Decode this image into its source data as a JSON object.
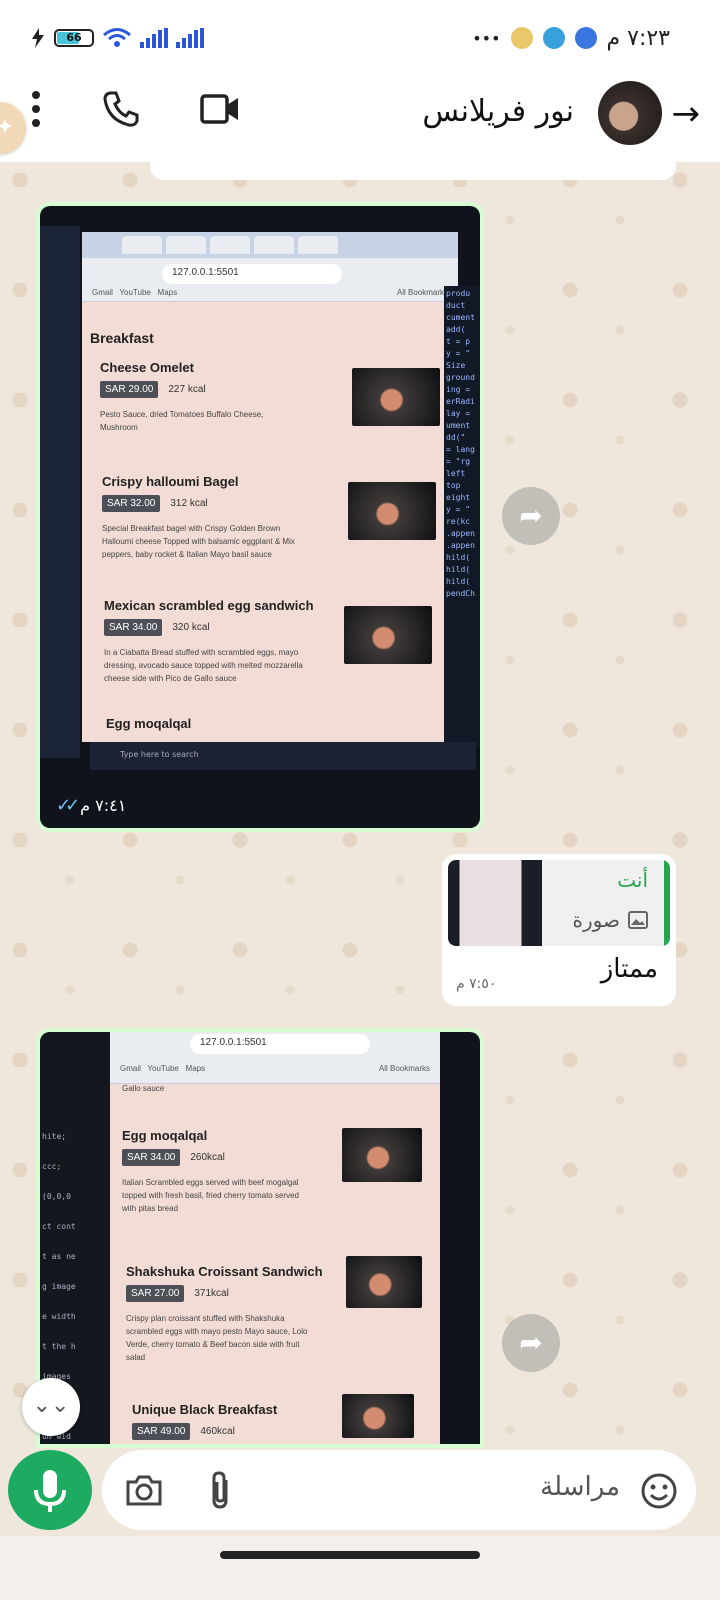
{
  "status_bar": {
    "time": "٧:٢٣ م",
    "battery": "66",
    "overflow": "•••"
  },
  "header": {
    "contact_name": "نور فريلانس",
    "back": "→"
  },
  "messages": [
    {
      "type": "image",
      "direction": "incoming",
      "time": "٧:٤١ م",
      "screen": {
        "url": "127.0.0.1:5501",
        "bookmarks": [
          "Gmail",
          "YouTube",
          "Maps"
        ],
        "all_bookmarks": "All Bookmarks",
        "section": "Breakfast",
        "items": [
          {
            "name": "Cheese Omelet",
            "price": "SAR 29.00",
            "kcal": "227 kcal",
            "desc": "Pesto Sauce, dried Tomatoes Buffalo Cheese, Mushroom"
          },
          {
            "name": "Crispy halloumi Bagel",
            "price": "SAR 32.00",
            "kcal": "312 kcal",
            "desc": "Special Breakfast bagel with Crispy Golden Brown Halloumi cheese Topped with balsamic eggplant & Mix peppers, baby rocket & Italian Mayo basil sauce"
          },
          {
            "name": "Mexican scrambled egg sandwich",
            "price": "SAR 34.00",
            "kcal": "320 kcal",
            "desc": "In a Ciabatta Bread stuffed with scrambled eggs, mayo dressing, avocado sauce topped with melted mozzarella cheese side with Pico de Gallo sauce"
          },
          {
            "name": "Egg moqalqal",
            "price": "",
            "kcal": "",
            "desc": ""
          }
        ],
        "search_placeholder": "Type here to search"
      }
    },
    {
      "type": "text",
      "direction": "outgoing",
      "reply_to": {
        "sender": "أنت",
        "kind": "صورة"
      },
      "text": "ممتاز",
      "time": "٧:٥٠ م"
    },
    {
      "type": "image",
      "direction": "incoming",
      "screen": {
        "url": "127.0.0.1:5501",
        "bookmarks": [
          "Gmail",
          "YouTube",
          "Maps"
        ],
        "all_bookmarks": "All Bookmarks",
        "top_fragment": "Gallo sauce",
        "items": [
          {
            "name": "Egg moqalqal",
            "price": "SAR 34.00",
            "kcal": "260kcal",
            "desc": "Italian Scrambled eggs served with beef mogalgal topped with fresh basil, fried cherry tomato served with pitas bread"
          },
          {
            "name": "Shakshuka Croissant Sandwich",
            "price": "SAR 27.00",
            "kcal": "371kcal",
            "desc": "Crispy plan croissant stuffed with Shakshuka scrambled eggs with mayo pesto Mayo sauce, Lolo Verde, cherry tomato & Beef bacon side with fruit salad"
          },
          {
            "name": "Unique Black Breakfast",
            "price": "SAR 49.00",
            "kcal": "460kcal",
            "desc": ""
          }
        ]
      }
    }
  ],
  "composer": {
    "placeholder": "مراسلة"
  },
  "icons": [
    "more-vert-icon",
    "phone-icon",
    "video-icon",
    "back-arrow-icon",
    "forward-icon",
    "image-icon",
    "camera-icon",
    "paperclip-icon",
    "emoji-icon",
    "mic-icon",
    "chevron-double-down-icon"
  ],
  "colors": {
    "accent_green": "#1daa61",
    "quote_green": "#25a550",
    "incoming_bubble": "#d9fdd3",
    "read_ticks": "#6ec6f5"
  }
}
